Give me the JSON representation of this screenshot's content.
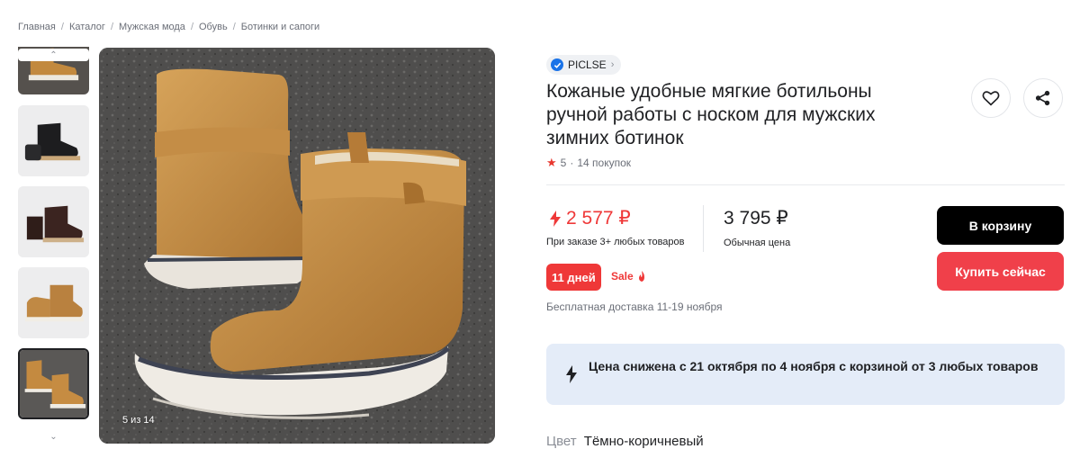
{
  "breadcrumbs": [
    "Главная",
    "Каталог",
    "Мужская мода",
    "Обувь",
    "Ботинки и сапоги"
  ],
  "gallery": {
    "counter": "5 из 14"
  },
  "brand": {
    "name": "PICLSE"
  },
  "product": {
    "title": "Кожаные удобные мягкие ботильоны ручной работы с носком для мужских зимних ботинок",
    "rating": "5",
    "separator": "·",
    "purchases": "14 покупок"
  },
  "price": {
    "sale": "2 577 ₽",
    "sale_note": "При заказе 3+ любых товаров",
    "regular": "3 795 ₽",
    "regular_note": "Обычная цена"
  },
  "badges": {
    "days": "11 дней",
    "sale": "Sale"
  },
  "delivery": "Бесплатная доставка 11-19 ноября",
  "buttons": {
    "cart": "В корзину",
    "buy_now": "Купить сейчас"
  },
  "promo": {
    "text": "Цена снижена с 21 октября по 4 ноября с корзиной от 3 любых товаров"
  },
  "color": {
    "label": "Цвет",
    "value": "Тёмно-коричневый"
  },
  "colors": {
    "accent_red": "#ef3838",
    "buy_button": "#f0404a",
    "cart_button": "#000000",
    "promo_bg": "#e4ecf8",
    "verified_blue": "#1a73e8"
  }
}
